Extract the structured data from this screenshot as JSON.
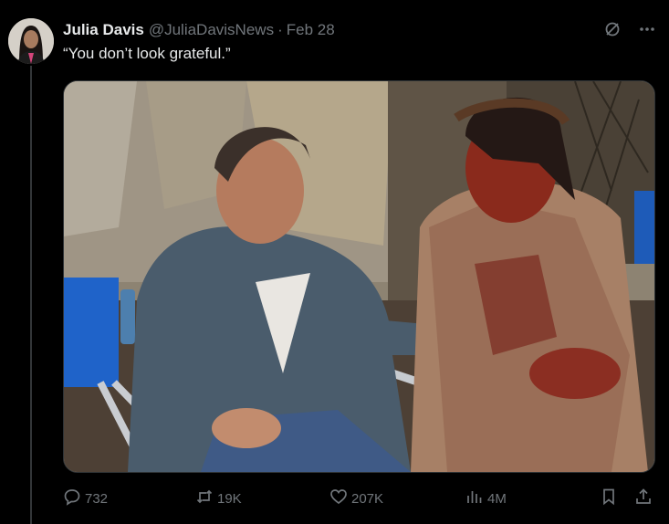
{
  "post": {
    "author_name": "Julia Davis",
    "author_handle": "@JuliaDavisNews",
    "separator": "·",
    "date": "Feb 28",
    "text": "“You don’t look grateful.”",
    "media_alt": "Photo of a director in a denim shirt gesturing toward an actor in a bloodied robe and crown of thorns on a film set"
  },
  "header_icons": [
    "grok-icon",
    "more-icon"
  ],
  "actions": {
    "replies": "732",
    "reposts": "19K",
    "likes": "207K",
    "views": "4M"
  },
  "colors": {
    "background": "#000000",
    "text": "#e7e9ea",
    "muted": "#71767b",
    "border": "#2f3336"
  }
}
